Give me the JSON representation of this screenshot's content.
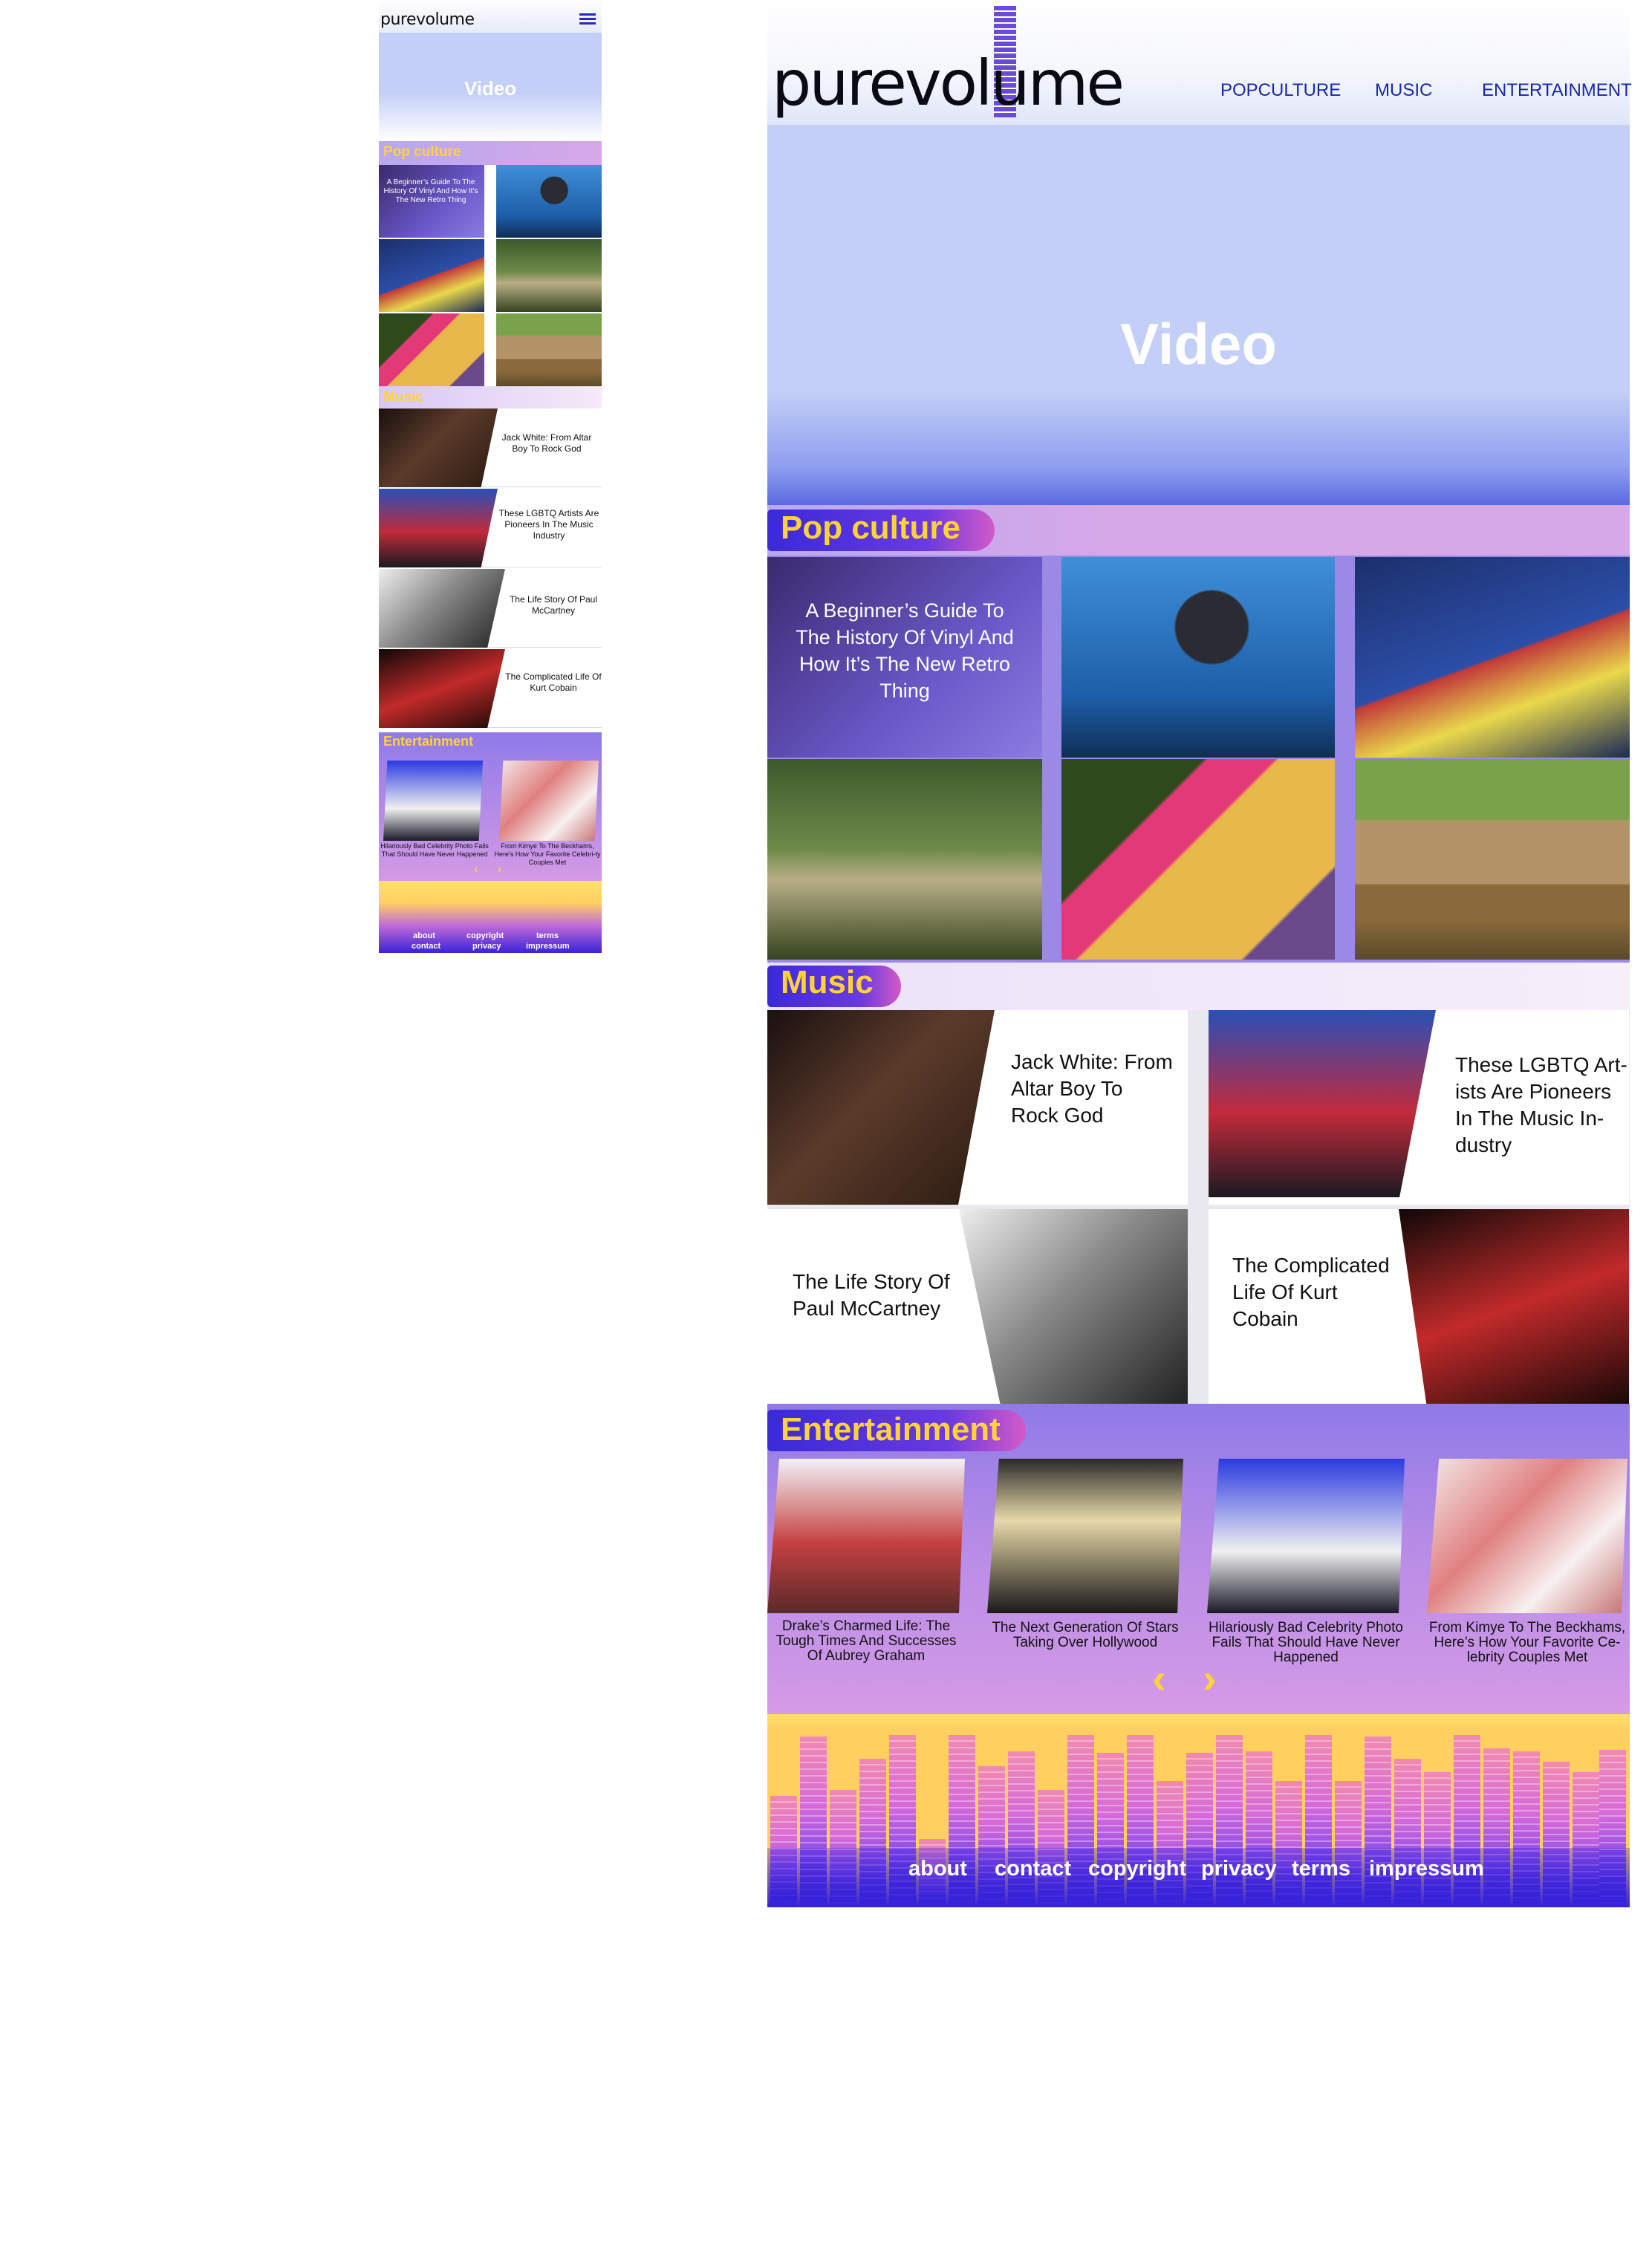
{
  "brand": {
    "logo_text": "purevolume"
  },
  "nav": [
    {
      "label": "POPCULTURE"
    },
    {
      "label": "MUSIC"
    },
    {
      "label": "ENTERTAINMENT"
    }
  ],
  "hero": {
    "title": "Video"
  },
  "popculture": {
    "title": "Pop culture",
    "feature_text": "A Beginner’s Guide To The History Of Vinyl And How It’s The New Retro Thing"
  },
  "music": {
    "title": "Music",
    "items": [
      {
        "title": "Jack White: From Altar Boy To Rock God"
      },
      {
        "title": "These LGBTQ Artists Are Pioneers In The Music Industry"
      },
      {
        "title": "The Life Story Of Paul McCartney"
      },
      {
        "title": "The Complicated Life Of Kurt Cobain"
      }
    ],
    "desktop_items": [
      {
        "title": "Jack White: From Altar Boy To Rock God"
      },
      {
        "title": "These LGBTQ Art-ists Are Pioneers In The Music In-dustry"
      },
      {
        "title": "The Life Story Of Paul McCartney"
      },
      {
        "title": "The Complicated Life Of Kurt Cobain"
      }
    ]
  },
  "entertainment": {
    "title": "Entertainment",
    "items": [
      {
        "caption": "Drake’s Charmed Life: The Tough Times And Successes Of Aubrey Graham"
      },
      {
        "caption": "The Next Generation Of Stars Taking Over Hollywood"
      },
      {
        "caption": "Hilariously Bad Celebrity Photo Fails That Should Have Never Happened"
      },
      {
        "caption": "From Kimye To The Beckhams, Here’s How Your Favorite Ce-lebrity Couples Met"
      }
    ],
    "mobile_items": [
      {
        "caption": "Hilariously Bad Celebrity Photo Fails That Should Have Never Happened"
      },
      {
        "caption": "From Kimye To The Beckhams, Here’s How Your Favorite Celebri-ty Couples Met"
      }
    ],
    "prev": "‹",
    "next": "›"
  },
  "footer": {
    "links": [
      {
        "label": "about"
      },
      {
        "label": "contact"
      },
      {
        "label": "copyright"
      },
      {
        "label": "privacy"
      },
      {
        "label": "terms"
      },
      {
        "label": "impressum"
      }
    ]
  },
  "colors": {
    "accent_yellow": "#ffd23a",
    "nav_blue": "#1a28a8",
    "hero_blue": "#c3cff6",
    "section_purple": "#b8a8f0"
  }
}
